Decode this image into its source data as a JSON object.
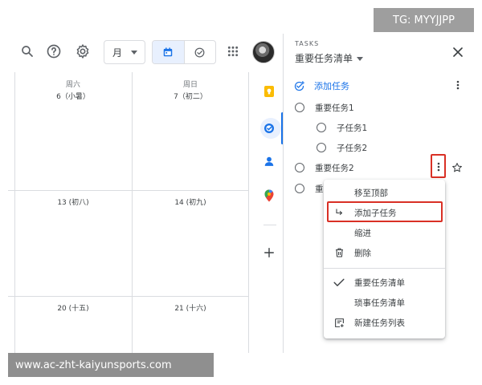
{
  "watermark": {
    "top": "TG: MYYJJPP",
    "bottom": "www.ac-zht-kaiyunsports.com"
  },
  "toolbar": {
    "view_select": "月"
  },
  "calendar": {
    "headers": [
      {
        "weekday": "周六",
        "date": "6（小暑）"
      },
      {
        "weekday": "周日",
        "date": "7（初二）"
      }
    ],
    "weeks": [
      {
        "sat": "13 (初八)",
        "sun": "14 (初九)"
      },
      {
        "sat": "20 (十五)",
        "sun": "21 (十六)"
      }
    ]
  },
  "tasks_panel": {
    "label": "TASKS",
    "list_title": "重要任务清单",
    "add_task": "添加任务",
    "tasks": [
      {
        "label": "重要任务1",
        "subtasks": [
          {
            "label": "子任务1"
          },
          {
            "label": "子任务2"
          }
        ]
      },
      {
        "label": "重要任务2"
      },
      {
        "label": "重"
      }
    ]
  },
  "context_menu": {
    "items": [
      {
        "label": "移至顶部",
        "icon": ""
      },
      {
        "label": "添加子任务",
        "icon": "subdirectory-arrow-icon"
      },
      {
        "label": "缩进",
        "icon": ""
      },
      {
        "label": "删除",
        "icon": "trash-icon"
      }
    ],
    "lists": [
      {
        "label": "重要任务清单",
        "icon": "check-icon"
      },
      {
        "label": "琐事任务清单",
        "icon": ""
      },
      {
        "label": "新建任务列表",
        "icon": "new-list-icon"
      }
    ]
  },
  "colors": {
    "accent": "#1a73e8",
    "highlight": "#d93025",
    "text": "#3c4043"
  }
}
